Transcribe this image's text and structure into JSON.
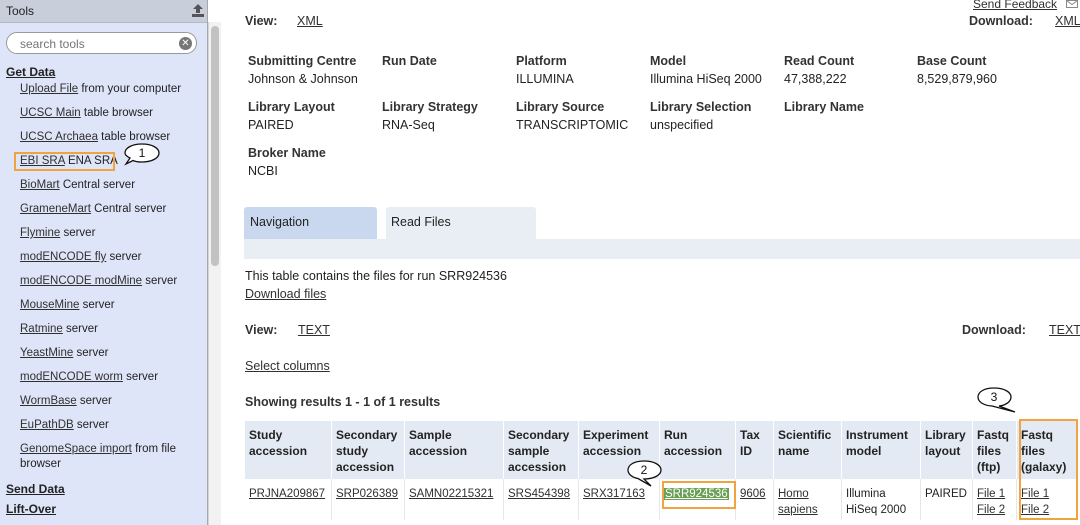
{
  "tools_panel": {
    "title": "Tools",
    "search_placeholder": "search tools",
    "sections": {
      "get_data": "Get Data",
      "send_data": "Send Data",
      "lift_over": "Lift-Over"
    },
    "items": [
      {
        "link": "Upload File",
        "rest": " from your computer"
      },
      {
        "link": "UCSC Main",
        "rest": " table browser"
      },
      {
        "link": "UCSC Archaea",
        "rest": " table browser"
      },
      {
        "link": "EBI SRA",
        "rest": " ENA SRA"
      },
      {
        "link": "BioMart",
        "rest": " Central server"
      },
      {
        "link": "GrameneMart",
        "rest": " Central server"
      },
      {
        "link": "Flymine",
        "rest": " server"
      },
      {
        "link": "modENCODE fly",
        "rest": " server"
      },
      {
        "link": "modENCODE modMine",
        "rest": " server"
      },
      {
        "link": "MouseMine",
        "rest": " server"
      },
      {
        "link": "Ratmine",
        "rest": " server"
      },
      {
        "link": "YeastMine",
        "rest": " server"
      },
      {
        "link": "modENCODE worm",
        "rest": " server"
      },
      {
        "link": "WormBase",
        "rest": " server"
      },
      {
        "link": "EuPathDB",
        "rest": " server"
      },
      {
        "link": "GenomeSpace import",
        "rest": " from file",
        "rest2": "browser"
      }
    ]
  },
  "callouts": [
    "1",
    "2",
    "3"
  ],
  "header": {
    "send_feedback": "Send Feedback",
    "view_label": "View:",
    "view_xml": "XML",
    "download_label": "Download:",
    "download_xml": "XML"
  },
  "run_info": {
    "submitting_centre": {
      "label": "Submitting Centre",
      "value": "Johnson & Johnson"
    },
    "run_date": {
      "label": "Run Date",
      "value": ""
    },
    "platform": {
      "label": "Platform",
      "value": "ILLUMINA"
    },
    "model": {
      "label": "Model",
      "value": "Illumina HiSeq 2000"
    },
    "read_count": {
      "label": "Read Count",
      "value": "47,388,222"
    },
    "base_count": {
      "label": "Base Count",
      "value": "8,529,879,960"
    },
    "library_layout": {
      "label": "Library Layout",
      "value": "PAIRED"
    },
    "library_strategy": {
      "label": "Library Strategy",
      "value": "RNA-Seq"
    },
    "library_source": {
      "label": "Library Source",
      "value": "TRANSCRIPTOMIC"
    },
    "library_selection": {
      "label": "Library Selection",
      "value": "unspecified"
    },
    "library_name": {
      "label": "Library Name",
      "value": ""
    },
    "broker_name": {
      "label": "Broker Name",
      "value": "NCBI"
    }
  },
  "tabs": {
    "navigation": "Navigation",
    "read_files": "Read Files"
  },
  "files": {
    "intro": "This table contains the files for run SRR924536",
    "download_files": "Download files",
    "view_label": "View:",
    "view_text": "TEXT",
    "download_label": "Download:",
    "download_text": "TEXT",
    "select_columns": "Select columns",
    "results": "Showing results 1 - 1 of 1 results"
  },
  "table": {
    "headers": [
      [
        "Study",
        "accession"
      ],
      [
        "Secondary",
        "study",
        "accession"
      ],
      [
        "Sample",
        "accession"
      ],
      [
        "Secondary",
        "sample",
        "accession"
      ],
      [
        "Experiment",
        "accession"
      ],
      [
        "Run",
        "accession"
      ],
      [
        "Tax",
        "ID"
      ],
      [
        "Scientific",
        "name"
      ],
      [
        "Instrument",
        "model"
      ],
      [
        "Library",
        "layout"
      ],
      [
        "Fastq",
        "files",
        "(ftp)"
      ],
      [
        "Fastq",
        "files",
        "(galaxy)"
      ]
    ],
    "row": {
      "study": "PRJNA209867",
      "secondary_study": "SRP026389",
      "sample": "SAMN02215321",
      "secondary_sample": "SRS454398",
      "experiment": "SRX317163",
      "run": "SRR924536",
      "tax_id": "9606",
      "scientific_name": [
        "Homo",
        "sapiens"
      ],
      "instrument": [
        "Illumina",
        "HiSeq 2000"
      ],
      "layout": "PAIRED",
      "ftp": [
        "File 1",
        "File 2"
      ],
      "galaxy": [
        "File 1",
        "File 2"
      ]
    }
  },
  "colors": {
    "highlight_box": "#f0a33e",
    "run_highlight": "#6a9f56",
    "panel_bg": "#dfe5f9"
  }
}
